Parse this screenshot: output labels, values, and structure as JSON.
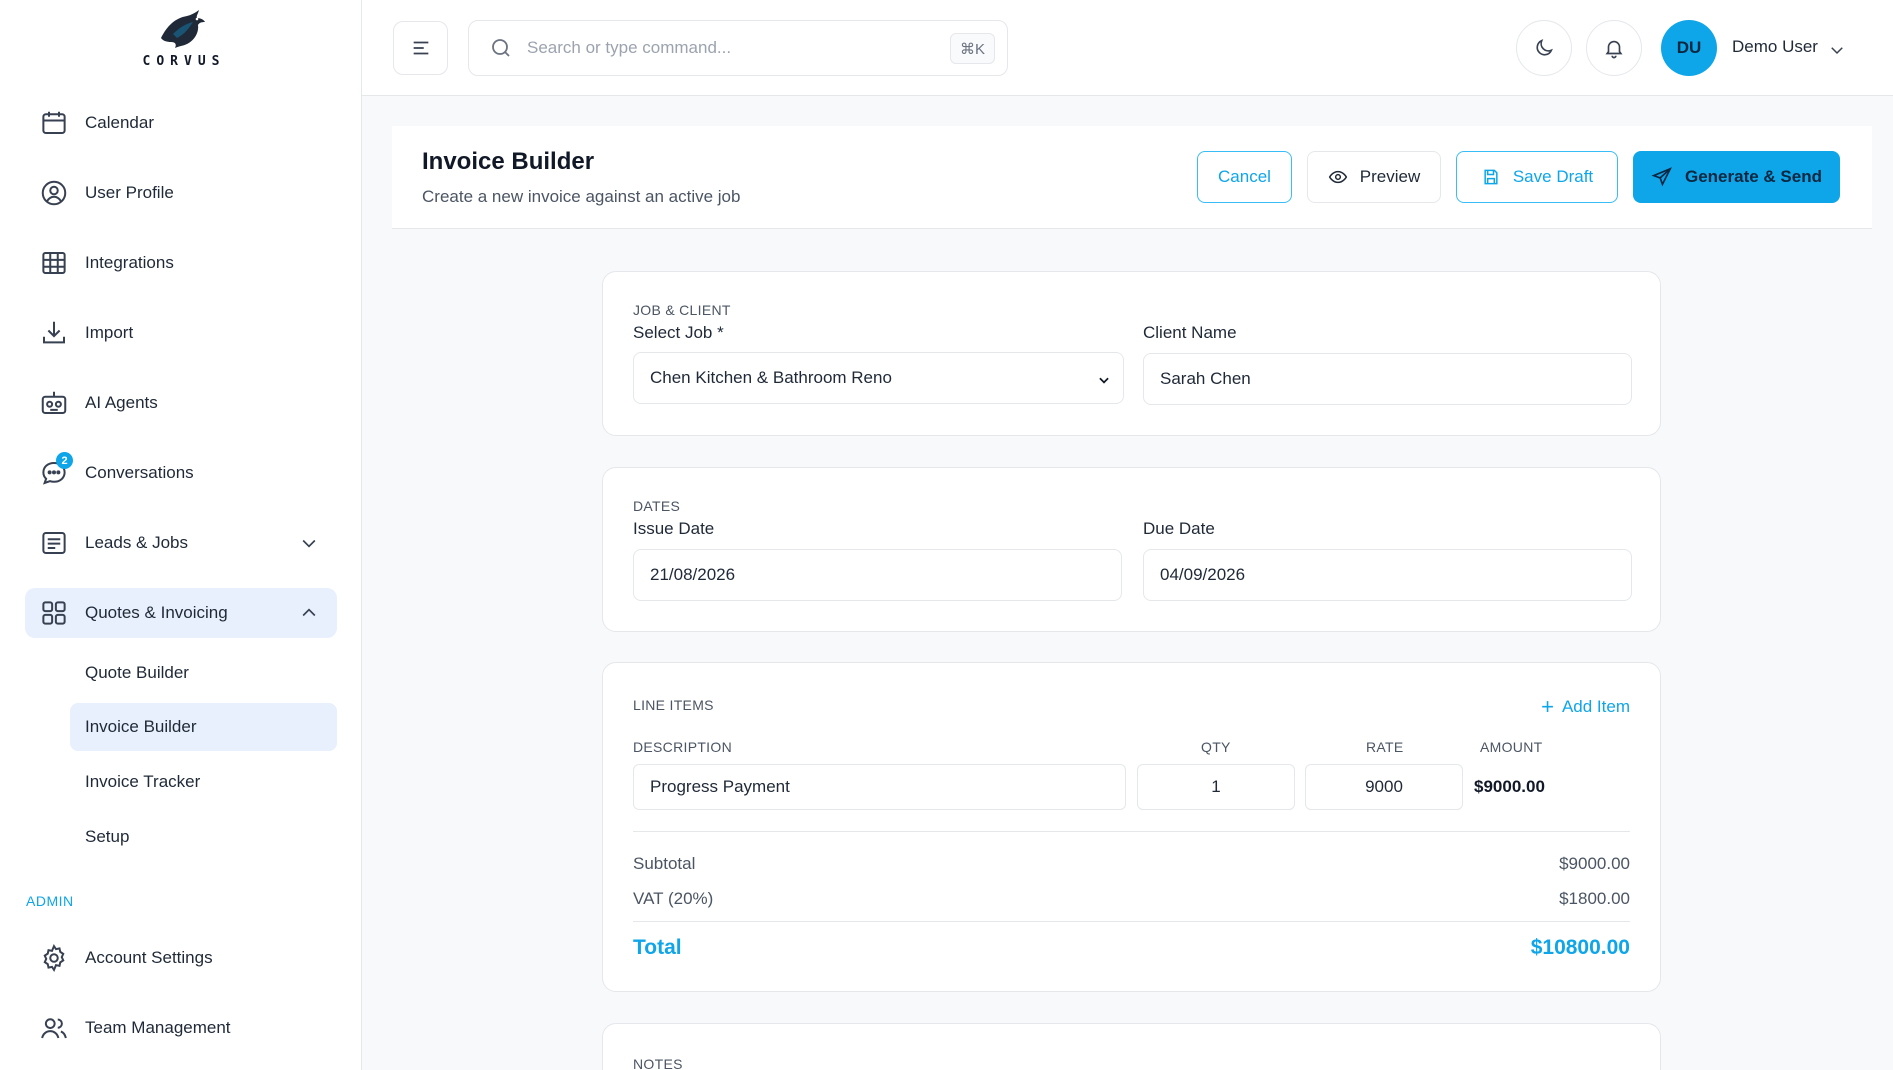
{
  "brand": {
    "name": "CORVUS"
  },
  "sidebar": {
    "items": [
      {
        "label": "Calendar",
        "icon": "calendar-icon"
      },
      {
        "label": "User Profile",
        "icon": "user-circle-icon"
      },
      {
        "label": "Integrations",
        "icon": "grid-table-icon"
      },
      {
        "label": "Import",
        "icon": "download-icon"
      },
      {
        "label": "AI Agents",
        "icon": "robot-icon"
      },
      {
        "label": "Conversations",
        "icon": "chat-bubble-icon",
        "badge": "2"
      },
      {
        "label": "Leads & Jobs",
        "icon": "list-icon"
      },
      {
        "label": "Quotes & Invoicing",
        "icon": "apps-grid-icon"
      }
    ],
    "sub_items": [
      {
        "label": "Quote Builder"
      },
      {
        "label": "Invoice Builder"
      },
      {
        "label": "Invoice Tracker"
      },
      {
        "label": "Setup"
      }
    ],
    "admin_label": "ADMIN",
    "admin_items": [
      {
        "label": "Account Settings",
        "icon": "gear-icon"
      },
      {
        "label": "Team Management",
        "icon": "users-icon"
      }
    ]
  },
  "topbar": {
    "search_placeholder": "Search or type command...",
    "shortcut": "⌘K",
    "avatar_initials": "DU",
    "user_name": "Demo User"
  },
  "page": {
    "title": "Invoice Builder",
    "subtitle": "Create a new invoice against an active job",
    "buttons": {
      "cancel": "Cancel",
      "preview": "Preview",
      "save_draft": "Save Draft",
      "generate_send": "Generate & Send"
    }
  },
  "job_client": {
    "section_label": "JOB & CLIENT",
    "job_label": "Select Job *",
    "job_value": "Chen Kitchen & Bathroom Reno",
    "client_label": "Client Name",
    "client_value": "Sarah Chen"
  },
  "dates": {
    "section_label": "DATES",
    "issue_label": "Issue Date",
    "issue_value": "21/08/2026",
    "due_label": "Due Date",
    "due_value": "04/09/2026"
  },
  "line_items": {
    "section_label": "LINE ITEMS",
    "add_label": "Add Item",
    "columns": {
      "description": "DESCRIPTION",
      "qty": "QTY",
      "rate": "RATE",
      "amount": "AMOUNT"
    },
    "rows": [
      {
        "description": "Progress Payment",
        "qty": "1",
        "rate": "9000",
        "amount": "$9000.00"
      }
    ],
    "subtotal_label": "Subtotal",
    "subtotal_value": "$9000.00",
    "vat_label": "VAT (20%)",
    "vat_value": "$1800.00",
    "total_label": "Total",
    "total_value": "$10800.00"
  },
  "notes": {
    "section_label": "NOTES"
  },
  "colors": {
    "accent": "#0ea5e9",
    "active_bg": "#e8f0fd",
    "border": "#e5e7eb"
  }
}
